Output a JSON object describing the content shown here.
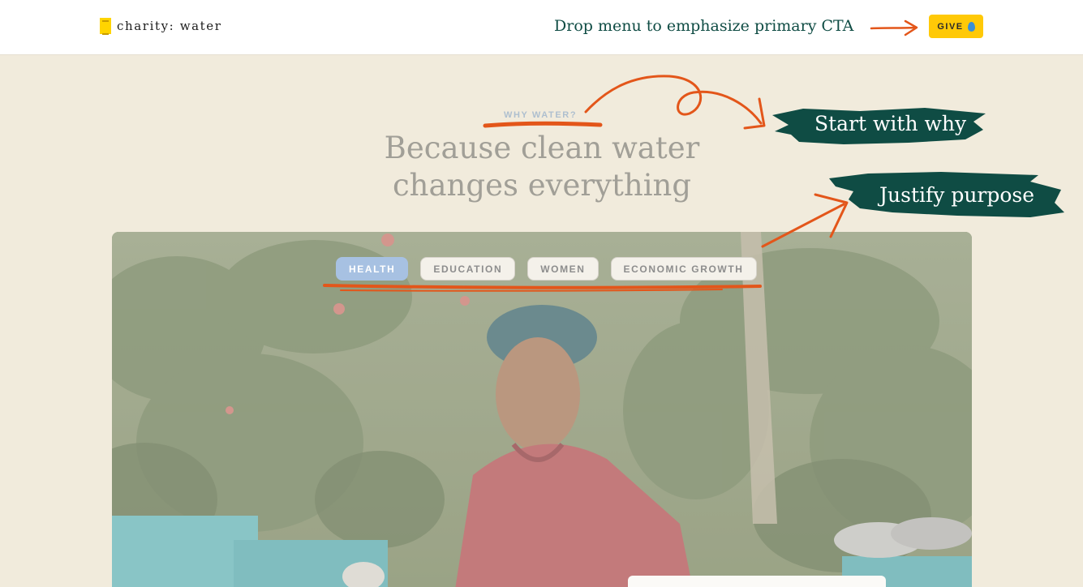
{
  "header": {
    "logo_text": "charity: water",
    "note": "Drop menu to emphasize primary CTA",
    "give_label": "GIVE"
  },
  "hero": {
    "eyebrow": "WHY WATER?",
    "heading_line1": "Because clean water",
    "heading_line2": "changes everything"
  },
  "tabs": [
    {
      "label": "HEALTH",
      "active": true
    },
    {
      "label": "EDUCATION",
      "active": false
    },
    {
      "label": "WOMEN",
      "active": false
    },
    {
      "label": "ECONOMIC GROWTH",
      "active": false
    }
  ],
  "annotations": {
    "start_with_why": "Start with why",
    "justify_purpose": "Justify purpose"
  },
  "colors": {
    "accent_orange": "#e3561a",
    "annotation_teal": "#0f4c44",
    "give_yellow": "#ffc907",
    "background": "#f1ebdc"
  },
  "icons": [
    "logo-mark-icon",
    "water-drop-icon",
    "arrow-right-icon"
  ]
}
